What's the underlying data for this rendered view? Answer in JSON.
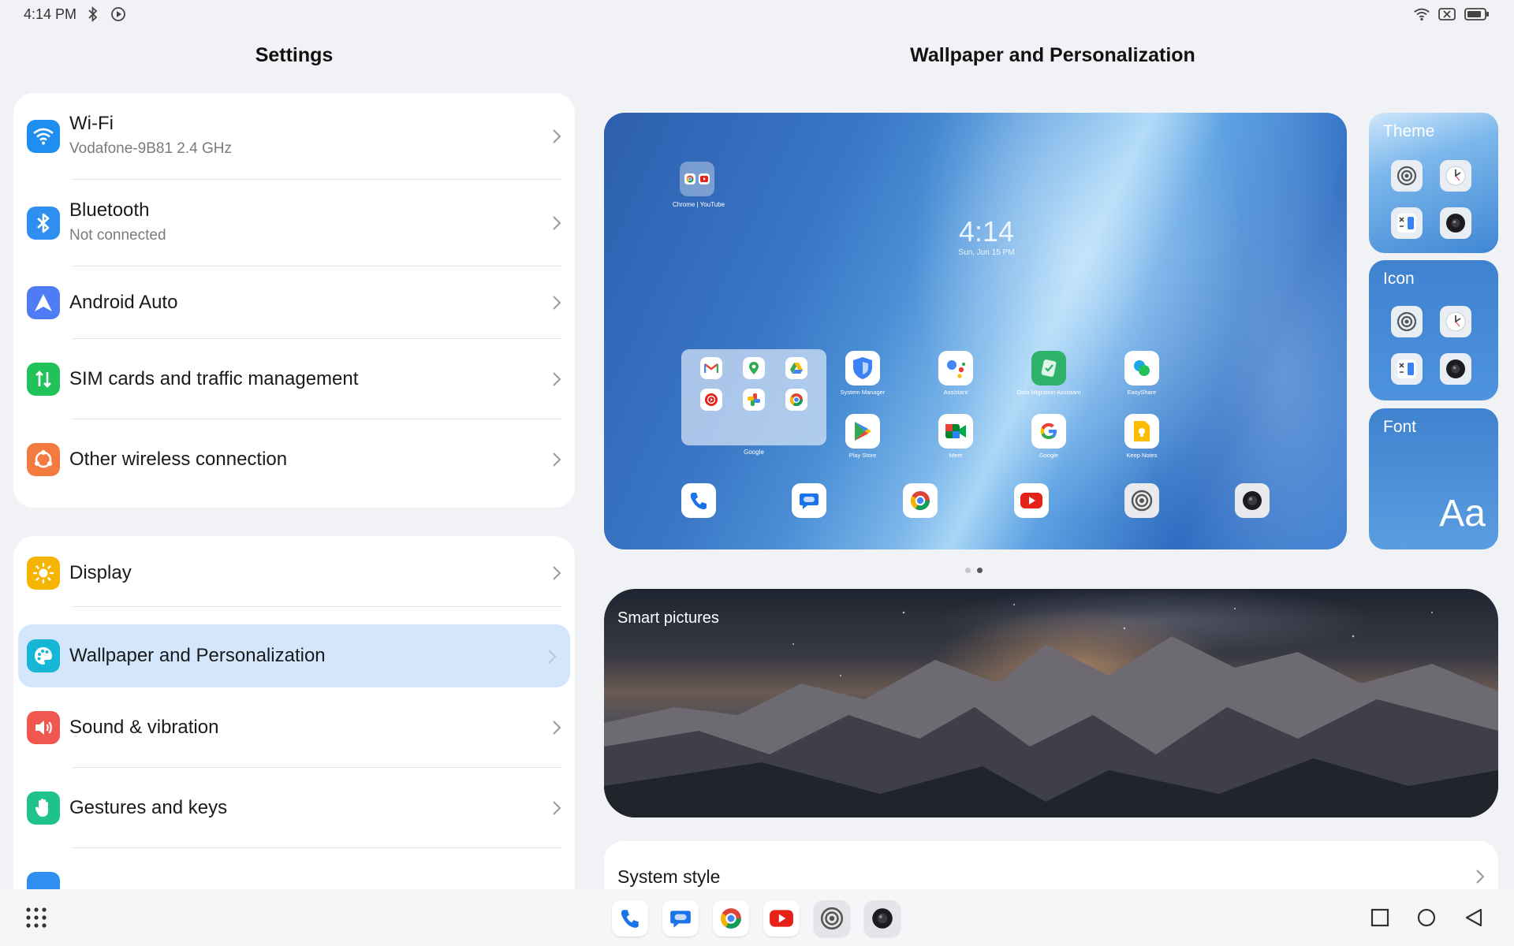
{
  "status_bar": {
    "time": "4:14 PM"
  },
  "left": {
    "title": "Settings",
    "group1": [
      {
        "label": "Wi-Fi",
        "sub": "Vodafone-9B81 2.4 GHz",
        "icon": "wifi-icon",
        "color": "#1f8ef1"
      },
      {
        "label": "Bluetooth",
        "sub": "Not connected",
        "icon": "bluetooth-icon",
        "color": "#2f8ff0"
      },
      {
        "label": "Android Auto",
        "icon": "android-auto-icon",
        "color": "#4f7cf4"
      },
      {
        "label": "SIM cards and traffic management",
        "icon": "sim-icon",
        "color": "#22c25a"
      },
      {
        "label": "Other wireless connection",
        "icon": "wireless-icon",
        "color": "#f47b3f"
      }
    ],
    "group2": [
      {
        "label": "Display",
        "icon": "sun-icon",
        "color": "#f5b400"
      },
      {
        "label": "Wallpaper and Personalization",
        "icon": "palette-icon",
        "color": "#16b6d6",
        "selected": true
      },
      {
        "label": "Sound & vibration",
        "icon": "speaker-icon",
        "color": "#f0574f"
      },
      {
        "label": "Gestures and keys",
        "icon": "hand-icon",
        "color": "#1fc28a"
      }
    ]
  },
  "right": {
    "title": "Wallpaper and Personalization",
    "preview": {
      "clock": "4:14",
      "date": "Sun, Jun 15 PM",
      "small_folder": "Chrome | YouTube",
      "folder": "Google",
      "apps_row1": [
        "System Manager",
        "Assistant",
        "Data Migration Assistant",
        "EasyShare"
      ],
      "apps_row2": [
        "Play Store",
        "Meet",
        "Google",
        "Keep Notes"
      ]
    },
    "side_cards": {
      "theme": "Theme",
      "icon": "Icon",
      "font": "Font",
      "font_sample": "Aa"
    },
    "smart_pictures": "Smart pictures",
    "system_style": "System style"
  },
  "colors": {
    "accent_selected": "#d3e6fb",
    "background": "#f1f2f6"
  }
}
